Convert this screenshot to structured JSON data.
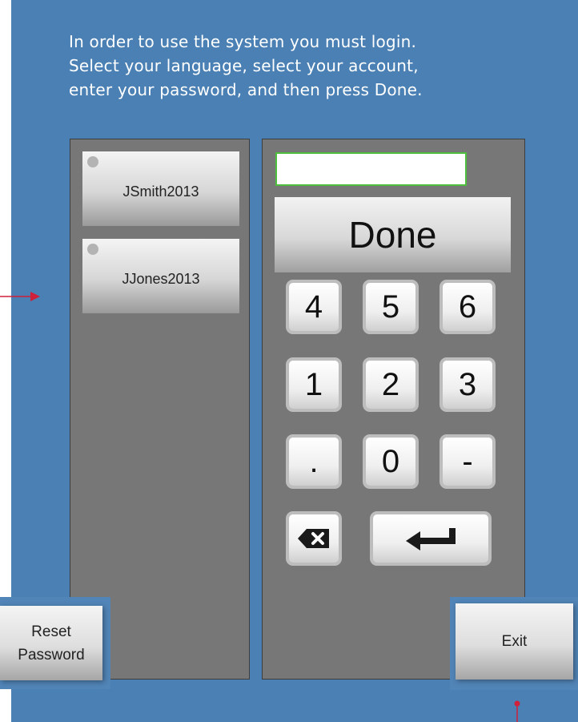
{
  "instructions": {
    "line1": "In order to use the system you must login.",
    "line2": "Select your language, select your account,",
    "line3": "enter your password, and then press Done."
  },
  "accounts": [
    {
      "name": "JSmith2013",
      "selected": false
    },
    {
      "name": "JJones2013",
      "selected": false
    }
  ],
  "password": {
    "value": "",
    "placeholder": ""
  },
  "keypad": {
    "done_label": "Done",
    "rows": [
      [
        "4",
        "5",
        "6"
      ],
      [
        "1",
        "2",
        "3"
      ],
      [
        ".",
        "0",
        "-"
      ]
    ],
    "backspace_icon": "backspace-icon",
    "enter_icon": "enter-arrow-icon"
  },
  "buttons": {
    "reset_line1": "Reset",
    "reset_line2": "Password",
    "exit_label": "Exit"
  },
  "colors": {
    "background": "#4a80b4",
    "panel": "#777777",
    "field_border": "#4dbe3e",
    "marker": "#d0203a"
  }
}
